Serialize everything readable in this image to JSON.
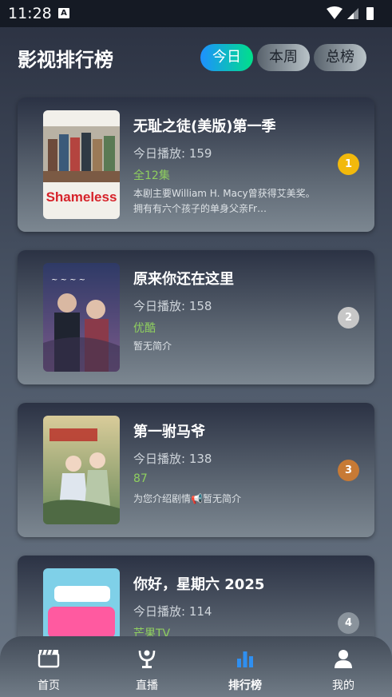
{
  "status_bar": {
    "time": "11:28",
    "notification_icon": "A"
  },
  "header": {
    "title": "影视排行榜"
  },
  "tabs": [
    {
      "label": "今日",
      "active": true
    },
    {
      "label": "本周",
      "active": false
    },
    {
      "label": "总榜",
      "active": false
    }
  ],
  "items": [
    {
      "title": "无耻之徒(美版)第一季",
      "plays_label": "今日播放: ",
      "plays": "159",
      "source": "全12集",
      "description": "本剧主要William H. Macy曾获得艾美奖。   拥有有六个孩子的单身父亲Fr…",
      "rank": "1",
      "rank_color": "#f2b90c",
      "poster_text": "Shameless"
    },
    {
      "title": "原来你还在这里",
      "plays_label": "今日播放: ",
      "plays": "158",
      "source": "优酷",
      "description": "暂无简介",
      "rank": "2",
      "rank_color": "#c7c7c7"
    },
    {
      "title": "第一驸马爷",
      "plays_label": "今日播放: ",
      "plays": "138",
      "source": "87",
      "description": "为您介绍剧情📢暂无简介",
      "rank": "3",
      "rank_color": "#c77a35"
    },
    {
      "title": "你好，星期六 2025",
      "plays_label": "今日播放: ",
      "plays": "114",
      "source": "芒果TV",
      "description": "",
      "rank": "4",
      "rank_color": "#8a939c"
    }
  ],
  "nav": [
    {
      "label": "首页",
      "icon": "clapperboard-icon",
      "active": false
    },
    {
      "label": "直播",
      "icon": "broadcast-icon",
      "active": false
    },
    {
      "label": "排行榜",
      "icon": "bar-chart-icon",
      "active": true
    },
    {
      "label": "我的",
      "icon": "user-icon",
      "active": false
    }
  ],
  "colors": {
    "accent": "#1e90ff",
    "accent_secondary": "#00e08a",
    "source_green": "#8fcf5f"
  }
}
